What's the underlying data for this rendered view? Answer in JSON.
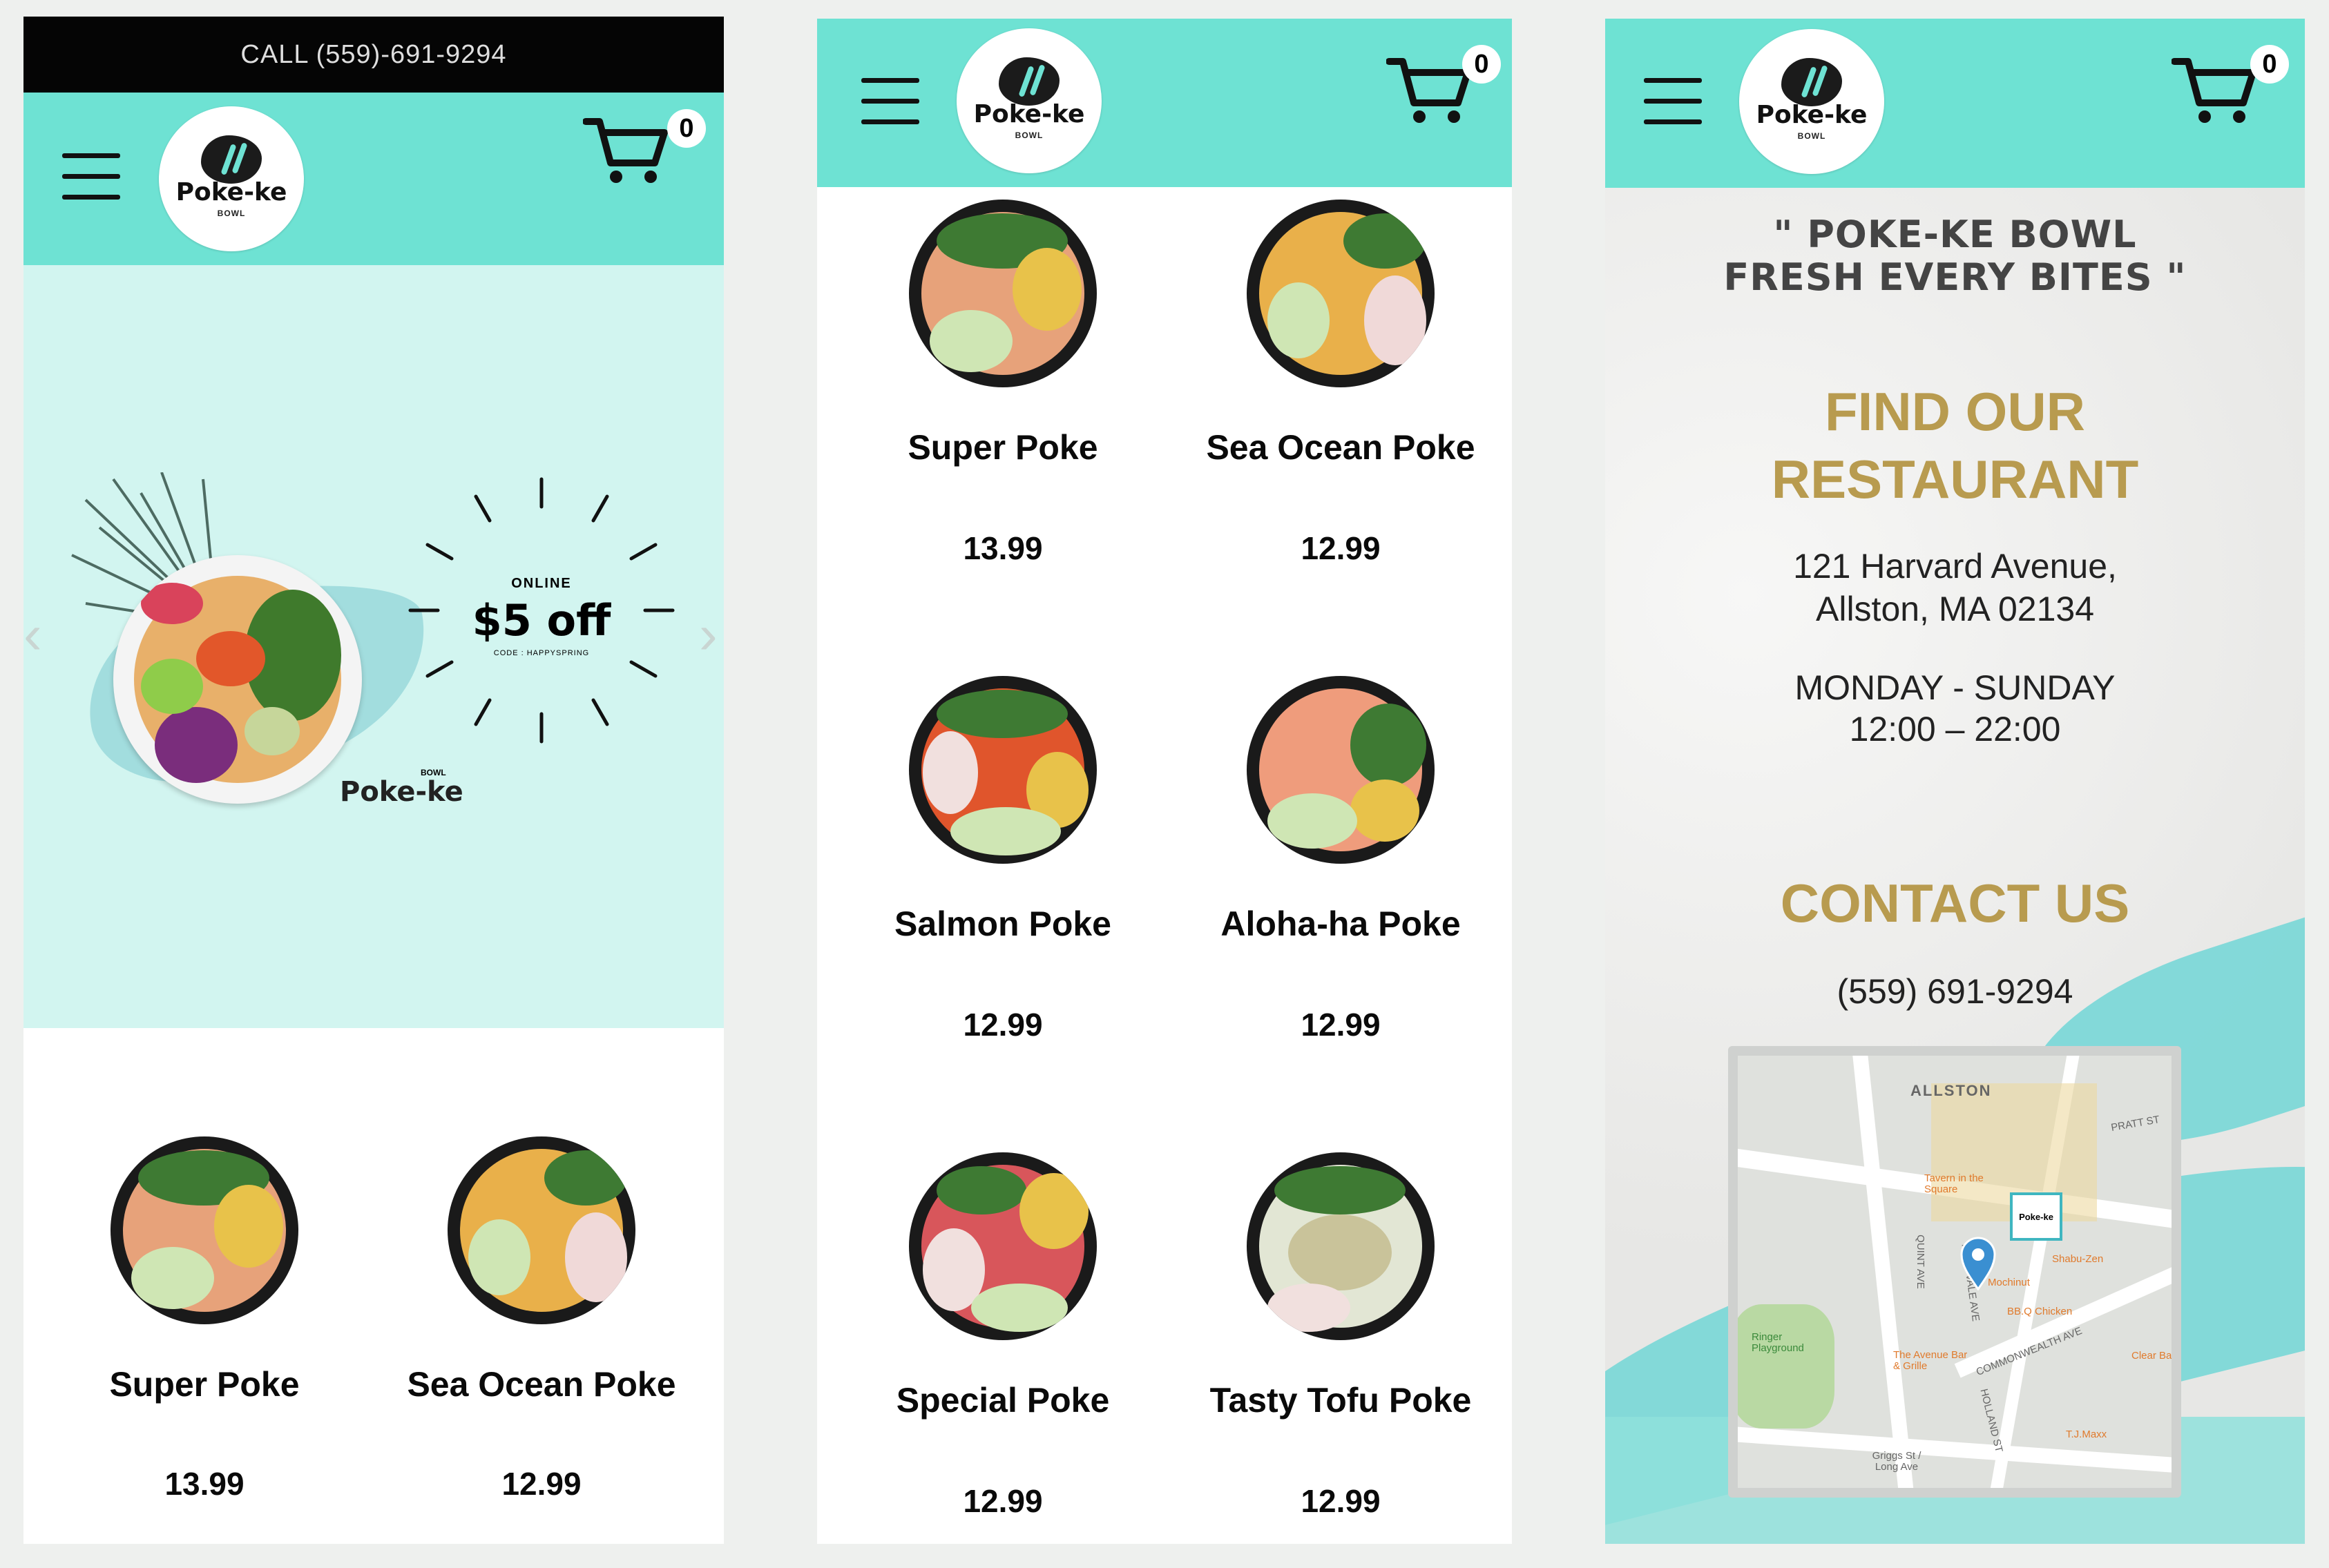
{
  "brand": {
    "name": "Poke-ke",
    "sub": "BOWL",
    "colors": {
      "header": "#6ee2d3",
      "hero": "#d2f5f0",
      "gold": "#b89b4f",
      "callbar": "#050505"
    }
  },
  "callbar": {
    "text": "CALL (559)-691-9294"
  },
  "cart": {
    "count": "0",
    "icon": "cart-icon"
  },
  "menu_icon": "hamburger-icon",
  "promo": {
    "online": "ONLINE",
    "offer": "$5 off",
    "code": "CODE : HAPPYSPRING",
    "brand_small": "BOWL",
    "brand": "Poke-ke"
  },
  "screen1": {
    "items": [
      {
        "name": "Super Poke",
        "price": "13.99"
      },
      {
        "name": "Sea Ocean Poke",
        "price": "12.99"
      }
    ]
  },
  "screen2": {
    "items": [
      {
        "name": "Super Poke",
        "price": "13.99"
      },
      {
        "name": "Sea Ocean Poke",
        "price": "12.99"
      },
      {
        "name": "Salmon Poke",
        "price": "12.99"
      },
      {
        "name": "Aloha-ha Poke",
        "price": "12.99"
      },
      {
        "name": "Special Poke",
        "price": "12.99"
      },
      {
        "name": "Tasty Tofu Poke",
        "price": "12.99"
      }
    ]
  },
  "screen3": {
    "tagline_1": "\" POKE-KE BOWL",
    "tagline_2": "FRESH EVERY BITES \"",
    "find_1": "FIND OUR",
    "find_2": "RESTAURANT",
    "address_1": "121 Harvard Avenue,",
    "address_2": "Allston, MA 02134",
    "hours_days": "MONDAY - SUNDAY",
    "hours_time": "12:00 – 22:00",
    "contact_title": "CONTACT US",
    "phone": "(559) 691-9294",
    "map": {
      "area": "ALLSTON",
      "places": [
        "Tavern in the Square",
        "Shabu-Zen",
        "Mochinut",
        "BB.Q Chicken",
        "Ringer Playground",
        "The Avenue Bar & Grille",
        "Clear Ba",
        "T.J.Maxx",
        "Griggs St / Long Ave"
      ],
      "streets": [
        "COMMONWEALTH AVE",
        "PRATT ST",
        "QUINT AVE",
        "PARK VALE AVE",
        "HOLLAND ST"
      ],
      "pin_label": "Poke-ke"
    }
  }
}
